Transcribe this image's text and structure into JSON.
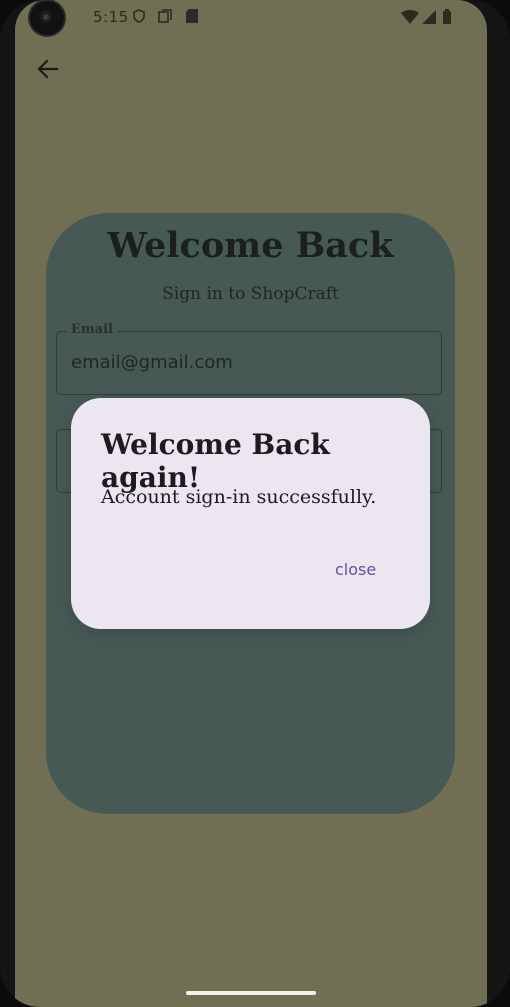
{
  "status_bar": {
    "time": "5:15",
    "icons": [
      "shield-icon",
      "copy-icon",
      "sd-card-icon",
      "wifi-icon",
      "signal-icon",
      "battery-icon"
    ]
  },
  "navigation": {
    "back_icon": "arrow-back-icon"
  },
  "login": {
    "title": "Welcome Back",
    "subtitle": "Sign in to ShopCraft",
    "email_label": "Email",
    "email_value": "email@gmail.com"
  },
  "dialog": {
    "title": "Welcome Back again!",
    "message": "Account sign-in successfully.",
    "close_label": "close"
  },
  "colors": {
    "background": "#716f53",
    "card": "#475955",
    "dialog": "#ebe6f0",
    "accent": "#6750a4"
  }
}
